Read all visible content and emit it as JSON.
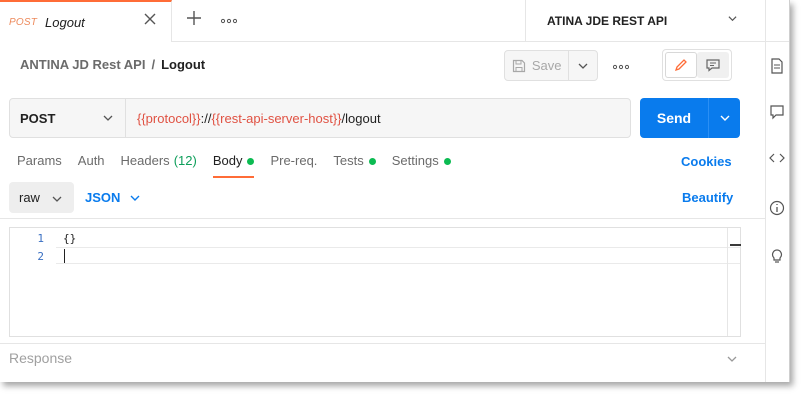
{
  "tab": {
    "method": "POST",
    "name": "Logout"
  },
  "environment": {
    "name": "ATINA JDE REST API"
  },
  "breadcrumb": {
    "collection": "ANTINA JD Rest API",
    "separator": "/",
    "request": "Logout"
  },
  "toolbar": {
    "save_label": "Save"
  },
  "request": {
    "method": "POST",
    "url_parts": {
      "var1": "{{protocol}}",
      "mid": "://",
      "var2": "{{rest-api-server-host}}",
      "path": "/logout"
    },
    "send_label": "Send"
  },
  "request_tabs": [
    {
      "label": "Params"
    },
    {
      "label": "Auth"
    },
    {
      "label": "Headers",
      "count": "(12)"
    },
    {
      "label": "Body"
    },
    {
      "label": "Pre-req."
    },
    {
      "label": "Tests"
    },
    {
      "label": "Settings"
    }
  ],
  "cookies_label": "Cookies",
  "body": {
    "mode": "raw",
    "language": "JSON",
    "beautify_label": "Beautify"
  },
  "editor": {
    "lines": [
      {
        "num": "1",
        "text": "{}"
      },
      {
        "num": "2",
        "text": ""
      }
    ]
  },
  "response": {
    "label": "Response"
  },
  "colors": {
    "accent": "#ff6c37",
    "primary": "#097bed",
    "variable": "#e05243",
    "dot": "#0cbb52"
  }
}
